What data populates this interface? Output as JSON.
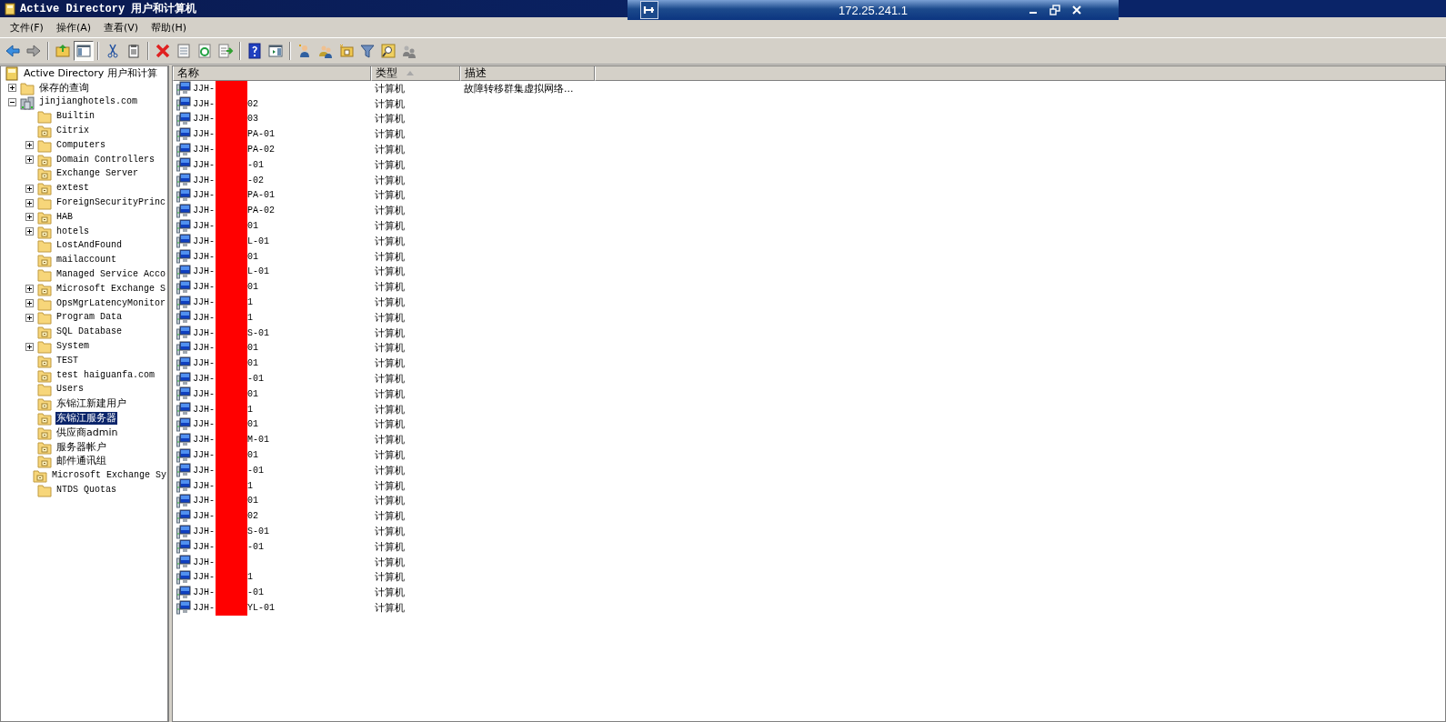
{
  "window": {
    "title": "Active Directory 用户和计算机"
  },
  "remote_bar": {
    "address": "172.25.241.1"
  },
  "menu": [
    "文件(F)",
    "操作(A)",
    "查看(V)",
    "帮助(H)"
  ],
  "toolbar": [
    {
      "kind": "back",
      "pressed": false
    },
    {
      "kind": "forward",
      "pressed": false
    },
    {
      "kind": "separator"
    },
    {
      "kind": "up",
      "pressed": false
    },
    {
      "kind": "tree",
      "pressed": true
    },
    {
      "kind": "separator"
    },
    {
      "kind": "cut",
      "pressed": false
    },
    {
      "kind": "paste",
      "pressed": false
    },
    {
      "kind": "separator"
    },
    {
      "kind": "delete",
      "pressed": false
    },
    {
      "kind": "properties",
      "pressed": false
    },
    {
      "kind": "refresh",
      "pressed": false
    },
    {
      "kind": "export",
      "pressed": false
    },
    {
      "kind": "separator"
    },
    {
      "kind": "help",
      "pressed": false
    },
    {
      "kind": "pane",
      "pressed": false
    },
    {
      "kind": "separator"
    },
    {
      "kind": "user",
      "pressed": false
    },
    {
      "kind": "group",
      "pressed": false
    },
    {
      "kind": "ou",
      "pressed": false
    },
    {
      "kind": "filter",
      "pressed": false
    },
    {
      "kind": "find",
      "pressed": false
    },
    {
      "kind": "delegate",
      "pressed": false
    }
  ],
  "tree": {
    "label": "Active Directory 用户和计算",
    "kind": "root",
    "selected": false,
    "children": [
      {
        "label": "保存的查询",
        "kind": "folder",
        "selected": false,
        "expanded": false
      },
      {
        "label": "jinjianghotels.com",
        "kind": "domain",
        "selected": false,
        "expanded": true,
        "children": [
          {
            "label": "Builtin",
            "kind": "folder",
            "selected": false
          },
          {
            "label": "Citrix",
            "kind": "ou",
            "selected": false
          },
          {
            "label": "Computers",
            "kind": "folder",
            "selected": false,
            "expanded": false
          },
          {
            "label": "Domain Controllers",
            "kind": "ou",
            "selected": false,
            "expanded": false
          },
          {
            "label": "Exchange Server",
            "kind": "ou",
            "selected": false
          },
          {
            "label": "extest",
            "kind": "ou",
            "selected": false,
            "expanded": false
          },
          {
            "label": "ForeignSecurityPrinc",
            "kind": "folder",
            "selected": false,
            "expanded": false
          },
          {
            "label": "HAB",
            "kind": "ou",
            "selected": false,
            "expanded": false
          },
          {
            "label": "hotels",
            "kind": "ou",
            "selected": false,
            "expanded": false
          },
          {
            "label": "LostAndFound",
            "kind": "folder",
            "selected": false
          },
          {
            "label": "mailaccount",
            "kind": "ou",
            "selected": false
          },
          {
            "label": "Managed Service Acco",
            "kind": "folder",
            "selected": false
          },
          {
            "label": "Microsoft Exchange S",
            "kind": "ou",
            "selected": false,
            "expanded": false
          },
          {
            "label": "OpsMgrLatencyMonitor",
            "kind": "folder",
            "selected": false,
            "expanded": false
          },
          {
            "label": "Program Data",
            "kind": "folder",
            "selected": false,
            "expanded": false
          },
          {
            "label": "SQL Database",
            "kind": "ou",
            "selected": false
          },
          {
            "label": "System",
            "kind": "folder",
            "selected": false,
            "expanded": false
          },
          {
            "label": "TEST",
            "kind": "ou",
            "selected": false
          },
          {
            "label": "test haiguanfa.com",
            "kind": "ou",
            "selected": false
          },
          {
            "label": "Users",
            "kind": "folder",
            "selected": false
          },
          {
            "label": "东锦江新建用户",
            "kind": "ou",
            "selected": false
          },
          {
            "label": "东锦江服务器",
            "kind": "ou",
            "selected": true
          },
          {
            "label": "供应商admin",
            "kind": "ou",
            "selected": false
          },
          {
            "label": "服务器帐户",
            "kind": "ou",
            "selected": false
          },
          {
            "label": "邮件通讯组",
            "kind": "ou",
            "selected": false
          },
          {
            "label": "Microsoft Exchange Sy",
            "kind": "ou",
            "selected": false
          },
          {
            "label": "NTDS Quotas",
            "kind": "folder",
            "selected": false
          }
        ]
      }
    ]
  },
  "table": {
    "columns": [
      {
        "label": "名称",
        "sorted": false
      },
      {
        "label": "类型",
        "sorted": true
      },
      {
        "label": "描述",
        "sorted": false
      }
    ],
    "rows": [
      {
        "name_start": "JJH-",
        "redacted": true,
        "name_end": "",
        "type": "计算机",
        "description": "故障转移群集虚拟网络..."
      },
      {
        "name_start": "JJH-",
        "redacted": true,
        "name_end": "02",
        "type": "计算机"
      },
      {
        "name_start": "JJH-",
        "redacted": true,
        "name_end": "03",
        "type": "计算机"
      },
      {
        "name_start": "JJH-",
        "redacted": true,
        "name_end": "PA-01",
        "type": "计算机"
      },
      {
        "name_start": "JJH-",
        "redacted": true,
        "name_end": "PA-02",
        "type": "计算机"
      },
      {
        "name_start": "JJH-",
        "redacted": true,
        "name_end": "-01",
        "type": "计算机"
      },
      {
        "name_start": "JJH-",
        "redacted": true,
        "name_end": "-02",
        "type": "计算机"
      },
      {
        "name_start": "JJH-",
        "redacted": true,
        "name_end": "PA-01",
        "type": "计算机"
      },
      {
        "name_start": "JJH-",
        "redacted": true,
        "name_end": "PA-02",
        "type": "计算机"
      },
      {
        "name_start": "JJH-",
        "redacted": true,
        "name_end": "01",
        "type": "计算机"
      },
      {
        "name_start": "JJH-",
        "redacted": true,
        "name_end": "L-01",
        "type": "计算机"
      },
      {
        "name_start": "JJH-",
        "redacted": true,
        "name_end": "01",
        "type": "计算机"
      },
      {
        "name_start": "JJH-",
        "redacted": true,
        "name_end": "L-01",
        "type": "计算机"
      },
      {
        "name_start": "JJH-",
        "redacted": true,
        "name_end": "01",
        "type": "计算机"
      },
      {
        "name_start": "JJH-",
        "redacted": true,
        "name_end": "1",
        "type": "计算机"
      },
      {
        "name_start": "JJH-",
        "redacted": true,
        "name_end": "1",
        "type": "计算机"
      },
      {
        "name_start": "JJH-",
        "redacted": true,
        "name_end": "S-01",
        "type": "计算机"
      },
      {
        "name_start": "JJH-",
        "redacted": true,
        "name_end": "01",
        "type": "计算机"
      },
      {
        "name_start": "JJH-",
        "redacted": true,
        "name_end": "01",
        "type": "计算机"
      },
      {
        "name_start": "JJH-",
        "redacted": true,
        "name_end": "-01",
        "type": "计算机"
      },
      {
        "name_start": "JJH-",
        "redacted": true,
        "name_end": "01",
        "type": "计算机"
      },
      {
        "name_start": "JJH-",
        "redacted": true,
        "name_end": "1",
        "type": "计算机"
      },
      {
        "name_start": "JJH-",
        "redacted": true,
        "name_end": "01",
        "type": "计算机"
      },
      {
        "name_start": "JJH-",
        "redacted": true,
        "name_end": "M-01",
        "type": "计算机"
      },
      {
        "name_start": "JJH-",
        "redacted": true,
        "name_end": "01",
        "type": "计算机"
      },
      {
        "name_start": "JJH-",
        "redacted": true,
        "name_end": "-01",
        "type": "计算机"
      },
      {
        "name_start": "JJH-",
        "redacted": true,
        "name_end": "1",
        "type": "计算机"
      },
      {
        "name_start": "JJH-",
        "redacted": true,
        "name_end": "01",
        "type": "计算机"
      },
      {
        "name_start": "JJH-",
        "redacted": true,
        "name_end": "02",
        "type": "计算机"
      },
      {
        "name_start": "JJH-",
        "redacted": true,
        "name_end": "S-01",
        "type": "计算机"
      },
      {
        "name_start": "JJH-",
        "redacted": true,
        "name_end": "-01",
        "type": "计算机"
      },
      {
        "name_start": "JJH-",
        "redacted": true,
        "name_end": "",
        "type": "计算机"
      },
      {
        "name_start": "JJH-",
        "redacted": true,
        "name_end": "1",
        "type": "计算机"
      },
      {
        "name_start": "JJH-",
        "redacted": true,
        "name_end": "-01",
        "type": "计算机"
      },
      {
        "name_start": "JJH-",
        "redacted": true,
        "name_end": "YL-01",
        "type": "计算机"
      }
    ]
  }
}
